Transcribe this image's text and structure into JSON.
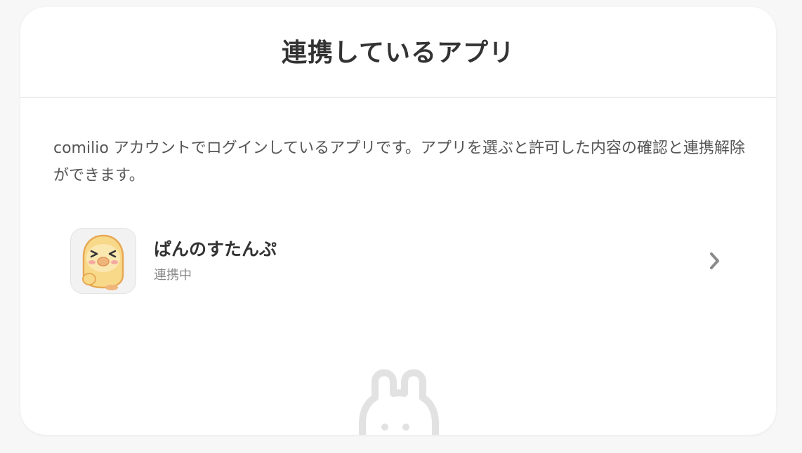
{
  "header": {
    "title": "連携しているアプリ"
  },
  "description": "comilio アカウントでログインしているアプリです。アプリを選ぶと許可した内容の確認と連携解除ができます。",
  "apps": [
    {
      "name": "ぱんのすたんぷ",
      "status": "連携中",
      "icon": "bread-character-icon"
    }
  ],
  "colors": {
    "background": "#f7f7f7",
    "card": "#ffffff",
    "text": "#333333",
    "muted": "#888888",
    "divider": "#ececec"
  }
}
